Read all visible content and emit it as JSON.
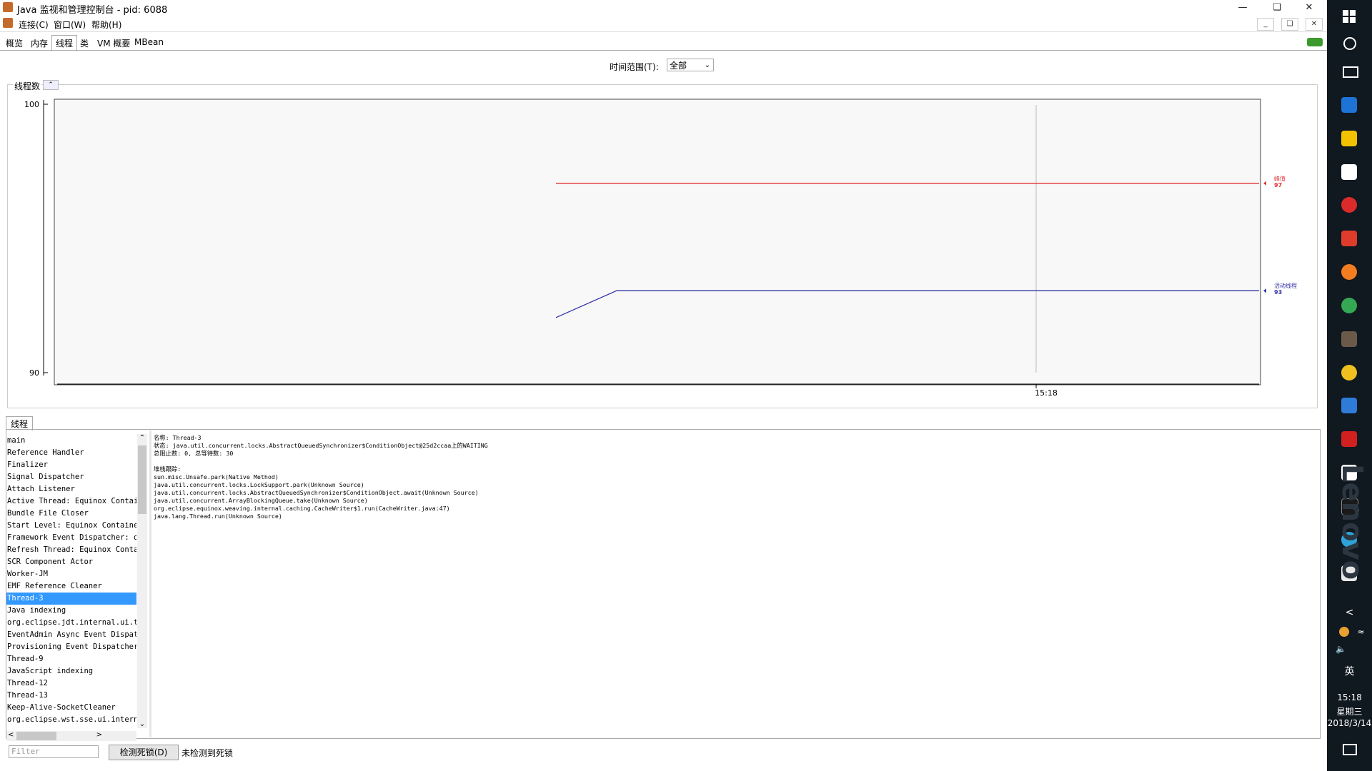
{
  "window": {
    "title": "Java 监视和管理控制台 - pid: 6088"
  },
  "menu": {
    "items": [
      "连接(C)",
      "窗口(W)",
      "帮助(H)"
    ]
  },
  "tabs": [
    "概览",
    "内存",
    "线程",
    "类",
    "VM 概要",
    "MBean"
  ],
  "active_tab": "线程",
  "time_range": {
    "label": "时间范围(T):",
    "value": "全部"
  },
  "chart_panel": {
    "title": "线程数"
  },
  "chart_data": {
    "type": "line",
    "title": "线程数",
    "ylim": [
      90,
      100
    ],
    "ytick_labels": [
      "100",
      "90"
    ],
    "xtick_labels": [
      "15:18"
    ],
    "series": [
      {
        "name": "峰值",
        "color": "#e03030",
        "values": [
          97,
          97,
          97
        ]
      },
      {
        "name": "活动线程",
        "color": "#3333aa",
        "values": [
          92,
          93,
          93
        ]
      }
    ],
    "legend": [
      {
        "name": "峰值",
        "value": "97"
      },
      {
        "name": "活动线程",
        "value": "93"
      }
    ]
  },
  "threads_tab": "线程",
  "threads": [
    "main",
    "Reference Handler",
    "Finalizer",
    "Signal Dispatcher",
    "Attach Listener",
    "Active Thread: Equinox Contain",
    "Bundle File Closer",
    "Start Level: Equinox Container",
    "Framework Event Dispatcher: or",
    "Refresh Thread: Equinox Contai",
    "SCR Component Actor",
    "Worker-JM",
    "EMF Reference Cleaner",
    "Thread-3",
    "Java indexing",
    "org.eclipse.jdt.internal.ui.te",
    "EventAdmin Async Event Dispatc",
    "Provisioning Event Dispatcher",
    "Thread-9",
    "JavaScript indexing",
    "Thread-12",
    "Thread-13",
    "Keep-Alive-SocketCleaner",
    "org.eclipse.wst.sse.ui.interna"
  ],
  "selected_thread": "Thread-3",
  "details": {
    "name_line": "名称: Thread-3",
    "state_line": "状态: java.util.concurrent.locks.AbstractQueuedSynchronizer$ConditionObject@25d2ccaa上的WAITING",
    "count_line": "总阻止数: 0, 总等待数: 30",
    "stack_label": "堆栈跟踪:",
    "stack": [
      "sun.misc.Unsafe.park(Native Method)",
      "java.util.concurrent.locks.LockSupport.park(Unknown Source)",
      "java.util.concurrent.locks.AbstractQueuedSynchronizer$ConditionObject.await(Unknown Source)",
      "java.util.concurrent.ArrayBlockingQueue.take(Unknown Source)",
      "org.eclipse.equinox.weaving.internal.caching.CacheWriter$1.run(CacheWriter.java:47)",
      "java.lang.Thread.run(Unknown Source)"
    ]
  },
  "filter": {
    "placeholder": "Filter"
  },
  "detect_button": "检测死锁(D)",
  "status": "未检测到死锁",
  "taskbar": {
    "time": "15:18",
    "weekday": "星期三",
    "date": "2018/3/14",
    "ime": "英",
    "watermark": "Lenovo",
    "colors": {
      "edge": "#1e73d6",
      "explorer": "#f2c200",
      "store": "#ffffff",
      "red1": "#d92b2b",
      "red2": "#e03c2c",
      "firefox": "#f47d20",
      "chrome": "#34a853",
      "java": "#e8e8e8"
    }
  }
}
